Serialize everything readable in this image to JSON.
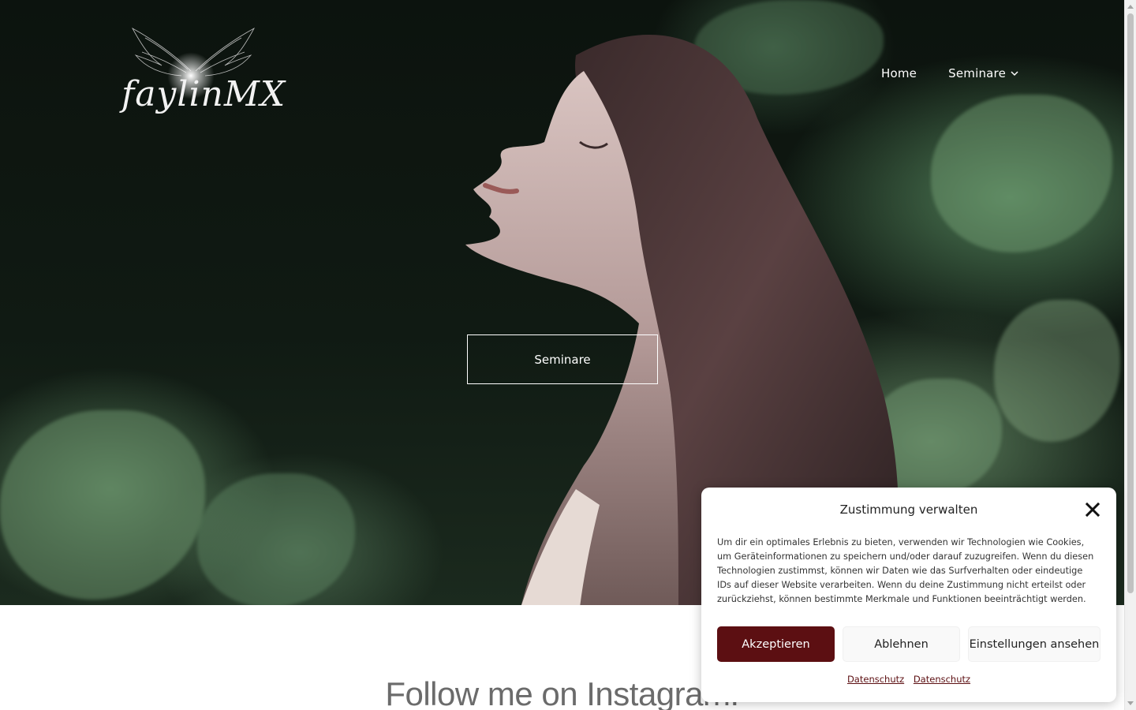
{
  "logo": {
    "text": "faylinMX"
  },
  "nav": {
    "items": [
      {
        "label": "Home"
      },
      {
        "label": "Seminare",
        "has_dropdown": true
      }
    ]
  },
  "hero": {
    "cta_label": "Seminare"
  },
  "instagram": {
    "title": "Follow me on Instagram!"
  },
  "consent": {
    "title": "Zustimmung verwalten",
    "body": "Um dir ein optimales Erlebnis zu bieten, verwenden wir Technologien wie Cookies, um Geräteinformationen zu speichern und/oder darauf zuzugreifen. Wenn du diesen Technologien zustimmst, können wir Daten wie das Surfverhalten oder eindeutige IDs auf dieser Website verarbeiten. Wenn du deine Zustimmung nicht erteilst oder zurückziehst, können bestimmte Merkmale und Funktionen beeinträchtigt werden.",
    "accept_label": "Akzeptieren",
    "decline_label": "Ablehnen",
    "settings_label": "Einstellungen ansehen",
    "links": [
      "Datenschutz",
      "Datenschutz"
    ]
  },
  "colors": {
    "brand": "#5c0f12",
    "hero_dark": "#0c130e",
    "foliage": "#588a60"
  }
}
